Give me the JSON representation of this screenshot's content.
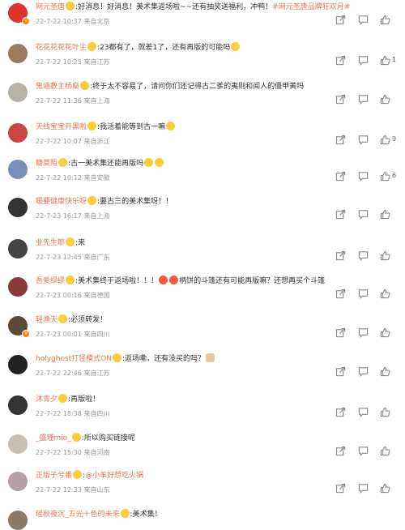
{
  "comments": [
    {
      "user": "网元圣唐",
      "text": "好消息！好消息！美术集返场啦~~还有抽奖送福利，冲鸭！",
      "link": "#网元圣唐品牌狂欢月#",
      "time": "22-7-22 10:37 来自北京",
      "likes": "",
      "avatar_color": "#d33",
      "verified": true
    },
    {
      "user": "花花花花花叶尘",
      "text": "23都有了，就差1了，还有再版的可能吗",
      "link": "",
      "time": "22-7-22 10:25 来自江苏",
      "likes": "1",
      "avatar_color": "#9a7b5f",
      "verified": false
    },
    {
      "user": "鬼道教主杨燊",
      "text": "终于太不容易了，请问你们还记得古二爹的夷则和闻人的僵甲黄吗",
      "link": "",
      "time": "22-7-22 11:36 来自上海",
      "likes": "",
      "avatar_color": "#b7b2a8",
      "verified": false
    },
    {
      "user": "天线宝宝开黑啦",
      "text": "我活着能等到古一嘛",
      "link": "",
      "time": "22-7-22 10:07 来自浙江",
      "likes": "9",
      "avatar_color": "#c44",
      "verified": false
    },
    {
      "user": "糖莫陌",
      "text": "古一美术集还能再版吗",
      "link": "",
      "time": "22-7-22 10:12 来自安徽",
      "likes": "6",
      "avatar_color": "#7a8fb8",
      "verified": false
    },
    {
      "user": "暖要健康快乐呀",
      "text": "要古三的美术集呀！！",
      "link": "",
      "time": "22-7-23 16:17 来自上海",
      "likes": "",
      "avatar_color": "#333",
      "verified": false
    },
    {
      "user": "业先生耶",
      "text": "来",
      "link": "",
      "time": "22-7-23 12:45 来自广东",
      "likes": "",
      "avatar_color": "#444",
      "verified": false
    },
    {
      "user": "吾爱缪缪",
      "text": "美术集终于返场啦！！！",
      "text2": "柄饼的斗篷还有可能再版嘛？还想再买个斗篷",
      "link": "",
      "time": "22-7-23 00:16 来自德国",
      "likes": "",
      "avatar_color": "#8a3a3a",
      "verified": false
    },
    {
      "user": "轻渔天",
      "text": "必须转发！",
      "link": "",
      "time": "22-7-23 00:01 来自四川",
      "likes": "",
      "avatar_color": "#5a4a3a",
      "verified": true
    },
    {
      "user": "holyghost打怪模式ON",
      "text": "返场嘞，还有没买的吗？",
      "link": "",
      "time": "22-7-22 22:46 来自江苏",
      "likes": "",
      "avatar_color": "#222",
      "verified": false
    },
    {
      "user": "沐青夕",
      "text": "再版啦！",
      "link": "",
      "time": "22-7-22 18:38 来自四川",
      "likes": "",
      "avatar_color": "#333",
      "verified": false
    },
    {
      "user": "_盛瑾mio_",
      "text": "所以购买链接呢",
      "link": "",
      "time": "22-7-22 15:30 来自河南",
      "likes": "",
      "avatar_color": "#c8c0b0",
      "verified": false
    },
    {
      "user": "正版子兮番",
      "text": "",
      "link": "@小羊好想吃火锅",
      "time": "22-7-22 12:33 来自山东",
      "likes": "",
      "avatar_color": "#b4a0a8",
      "verified": false
    },
    {
      "user": "瑶秋夜沉_五光十色的未来",
      "text": "美术集！",
      "link": "",
      "time": "",
      "likes": "",
      "avatar_color": "#8a7a6a",
      "verified": false
    }
  ]
}
